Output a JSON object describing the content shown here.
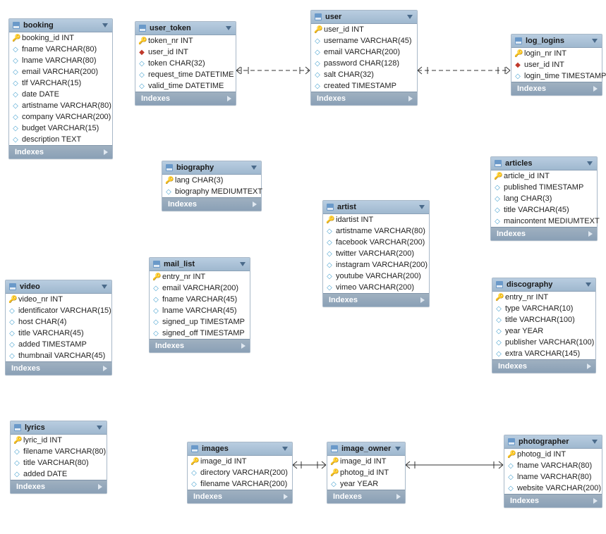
{
  "labels": {
    "indexes": "Indexes"
  },
  "tables": {
    "booking": {
      "name": "booking",
      "columns": [
        {
          "icon": "key",
          "text": "booking_id INT"
        },
        {
          "icon": "col",
          "text": "fname VARCHAR(80)"
        },
        {
          "icon": "col",
          "text": "lname VARCHAR(80)"
        },
        {
          "icon": "col",
          "text": "email VARCHAR(200)"
        },
        {
          "icon": "col",
          "text": "tlf VARCHAR(15)"
        },
        {
          "icon": "col",
          "text": "date DATE"
        },
        {
          "icon": "col",
          "text": "artistname VARCHAR(80)"
        },
        {
          "icon": "col",
          "text": "company VARCHAR(200)"
        },
        {
          "icon": "col",
          "text": "budget VARCHAR(15)"
        },
        {
          "icon": "col",
          "text": "description TEXT"
        }
      ]
    },
    "user_token": {
      "name": "user_token",
      "columns": [
        {
          "icon": "key",
          "text": "token_nr INT"
        },
        {
          "icon": "fk",
          "text": "user_id INT"
        },
        {
          "icon": "col",
          "text": "token CHAR(32)"
        },
        {
          "icon": "col",
          "text": "request_time DATETIME"
        },
        {
          "icon": "col",
          "text": "valid_time DATETIME"
        }
      ]
    },
    "user": {
      "name": "user",
      "columns": [
        {
          "icon": "key",
          "text": "user_id INT"
        },
        {
          "icon": "col",
          "text": "username VARCHAR(45)"
        },
        {
          "icon": "col",
          "text": "email VARCHAR(200)"
        },
        {
          "icon": "col",
          "text": "password CHAR(128)"
        },
        {
          "icon": "col",
          "text": "salt CHAR(32)"
        },
        {
          "icon": "col",
          "text": "created TIMESTAMP"
        }
      ]
    },
    "log_logins": {
      "name": "log_logins",
      "columns": [
        {
          "icon": "key",
          "text": "login_nr INT"
        },
        {
          "icon": "fk",
          "text": "user_id INT"
        },
        {
          "icon": "col",
          "text": "login_time TIMESTAMP"
        }
      ]
    },
    "biography": {
      "name": "biography",
      "columns": [
        {
          "icon": "key",
          "text": "lang CHAR(3)"
        },
        {
          "icon": "col",
          "text": "biography MEDIUMTEXT"
        }
      ]
    },
    "articles": {
      "name": "articles",
      "columns": [
        {
          "icon": "key",
          "text": "article_id INT"
        },
        {
          "icon": "col",
          "text": "published TIMESTAMP"
        },
        {
          "icon": "col",
          "text": "lang CHAR(3)"
        },
        {
          "icon": "col",
          "text": "title VARCHAR(45)"
        },
        {
          "icon": "col",
          "text": "maincontent MEDIUMTEXT"
        }
      ]
    },
    "mail_list": {
      "name": "mail_list",
      "columns": [
        {
          "icon": "key",
          "text": "entry_nr INT"
        },
        {
          "icon": "col",
          "text": "email VARCHAR(200)"
        },
        {
          "icon": "col",
          "text": "fname VARCHAR(45)"
        },
        {
          "icon": "col",
          "text": "lname VARCHAR(45)"
        },
        {
          "icon": "col",
          "text": "signed_up TIMESTAMP"
        },
        {
          "icon": "col",
          "text": "signed_off TIMESTAMP"
        }
      ]
    },
    "artist": {
      "name": "artist",
      "columns": [
        {
          "icon": "key",
          "text": "idartist INT"
        },
        {
          "icon": "col",
          "text": "artistname VARCHAR(80)"
        },
        {
          "icon": "col",
          "text": "facebook VARCHAR(200)"
        },
        {
          "icon": "col",
          "text": "twitter VARCHAR(200)"
        },
        {
          "icon": "col",
          "text": "instagram VARCHAR(200)"
        },
        {
          "icon": "col",
          "text": "youtube VARCHAR(200)"
        },
        {
          "icon": "col",
          "text": "vimeo VARCHAR(200)"
        }
      ]
    },
    "discography": {
      "name": "discography",
      "columns": [
        {
          "icon": "key",
          "text": "entry_nr INT"
        },
        {
          "icon": "col",
          "text": "type VARCHAR(10)"
        },
        {
          "icon": "col",
          "text": "title VARCHAR(100)"
        },
        {
          "icon": "col",
          "text": "year YEAR"
        },
        {
          "icon": "col",
          "text": "publisher VARCHAR(100)"
        },
        {
          "icon": "col",
          "text": "extra VARCHAR(145)"
        }
      ]
    },
    "video": {
      "name": "video",
      "columns": [
        {
          "icon": "key",
          "text": "video_nr INT"
        },
        {
          "icon": "col",
          "text": "identificator VARCHAR(15)"
        },
        {
          "icon": "col",
          "text": "host CHAR(4)"
        },
        {
          "icon": "col",
          "text": "title VARCHAR(45)"
        },
        {
          "icon": "col",
          "text": "added TIMESTAMP"
        },
        {
          "icon": "col",
          "text": "thumbnail VARCHAR(45)"
        }
      ]
    },
    "lyrics": {
      "name": "lyrics",
      "columns": [
        {
          "icon": "key",
          "text": "lyric_id INT"
        },
        {
          "icon": "col",
          "text": "filename VARCHAR(80)"
        },
        {
          "icon": "col",
          "text": "title VARCHAR(80)"
        },
        {
          "icon": "col",
          "text": "added DATE"
        }
      ]
    },
    "images": {
      "name": "images",
      "columns": [
        {
          "icon": "key",
          "text": "image_id INT"
        },
        {
          "icon": "col",
          "text": "directory VARCHAR(200)"
        },
        {
          "icon": "col",
          "text": "filename VARCHAR(200)"
        }
      ]
    },
    "image_owner": {
      "name": "image_owner",
      "columns": [
        {
          "icon": "key",
          "text": "image_id INT"
        },
        {
          "icon": "key",
          "text": "photog_id INT"
        },
        {
          "icon": "col",
          "text": "year YEAR"
        }
      ]
    },
    "photographer": {
      "name": "photographer",
      "columns": [
        {
          "icon": "key",
          "text": "photog_id INT"
        },
        {
          "icon": "col",
          "text": "fname VARCHAR(80)"
        },
        {
          "icon": "col",
          "text": "lname VARCHAR(80)"
        },
        {
          "icon": "col",
          "text": "website VARCHAR(200)"
        }
      ]
    }
  }
}
